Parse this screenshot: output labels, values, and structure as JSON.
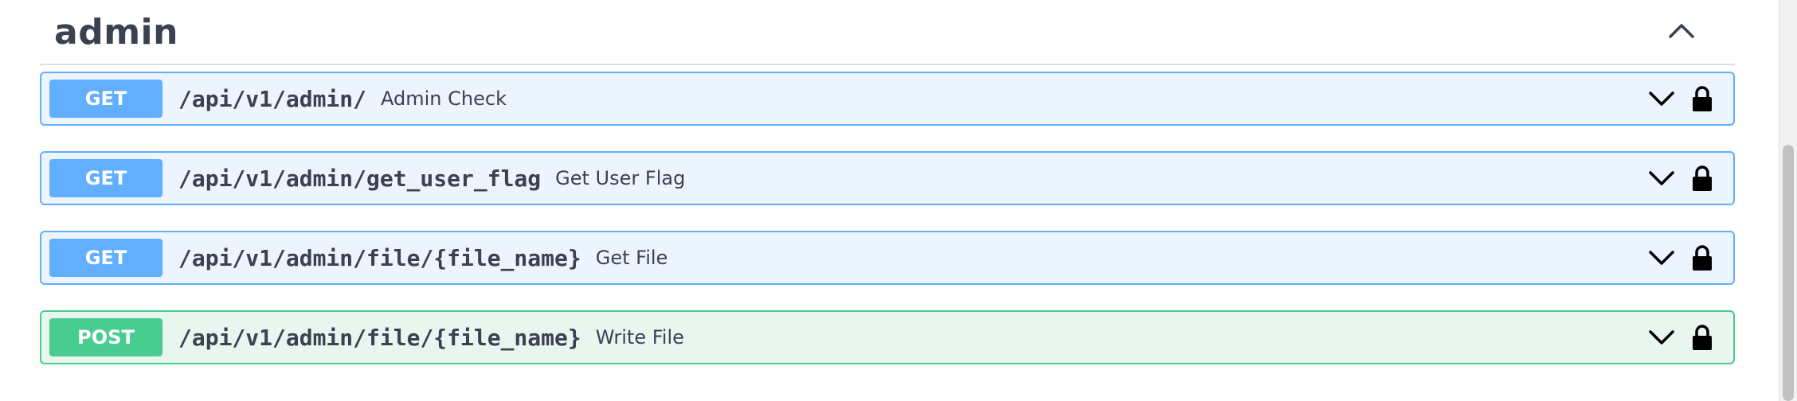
{
  "section": {
    "title": "admin",
    "collapse_icon": "chevron-up-icon"
  },
  "operations": [
    {
      "method": "GET",
      "path": "/api/v1/admin/",
      "summary": "Admin Check",
      "expand_icon": "chevron-down-icon",
      "auth_icon": "lock-icon"
    },
    {
      "method": "GET",
      "path": "/api/v1/admin/get_user_flag",
      "summary": "Get User Flag",
      "expand_icon": "chevron-down-icon",
      "auth_icon": "lock-icon"
    },
    {
      "method": "GET",
      "path": "/api/v1/admin/file/{file_name}",
      "summary": "Get File",
      "expand_icon": "chevron-down-icon",
      "auth_icon": "lock-icon"
    },
    {
      "method": "POST",
      "path": "/api/v1/admin/file/{file_name}",
      "summary": "Write File",
      "expand_icon": "chevron-down-icon",
      "auth_icon": "lock-icon"
    }
  ],
  "colors": {
    "get": "#61affe",
    "get_bg": "#ecf4fe",
    "post": "#49cc90",
    "post_bg": "#e9f6f0",
    "text": "#3b4151"
  }
}
